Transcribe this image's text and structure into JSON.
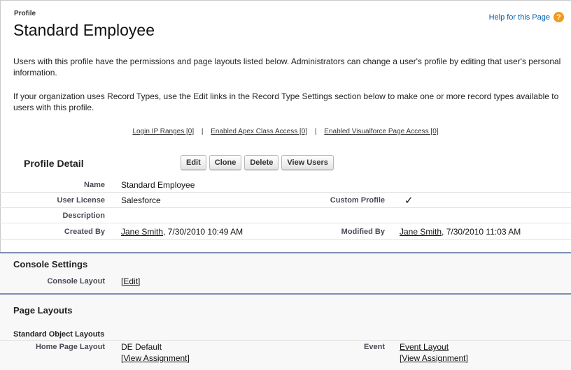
{
  "header": {
    "breadcrumb": "Profile",
    "title": "Standard Employee",
    "help_link": "Help for this Page",
    "help_icon": "question-icon"
  },
  "intro": {
    "paragraph1": "Users with this profile have the permissions and page layouts listed below. Administrators can change a user's profile by editing that user's personal information.",
    "paragraph2": "If your organization uses Record Types, use the Edit links in the Record Type Settings section below to make one or more record types available to users with this profile."
  },
  "quick_links": [
    "Login IP Ranges [0]",
    "Enabled Apex Class Access [0]",
    "Enabled Visualforce Page Access [0]"
  ],
  "quick_link_separator": "|",
  "profile_detail": {
    "heading": "Profile Detail",
    "buttons": [
      "Edit",
      "Clone",
      "Delete",
      "View Users"
    ],
    "name_label": "Name",
    "name_value": "Standard Employee",
    "user_license_label": "User License",
    "user_license_value": "Salesforce",
    "custom_profile_label": "Custom Profile",
    "custom_profile_checked": "✓",
    "description_label": "Description",
    "created_by_label": "Created By",
    "created_by_user": "Jane Smith",
    "created_by_date": ", 7/30/2010 10:49 AM",
    "modified_by_label": "Modified By",
    "modified_by_user": "Jane Smith",
    "modified_by_date": ", 7/30/2010 11:03 AM"
  },
  "console_settings": {
    "heading": "Console Settings",
    "console_layout_label": "Console Layout",
    "edit_link": "Edit",
    "bracket_open": "[",
    "bracket_close": "]"
  },
  "page_layouts": {
    "heading": "Page Layouts",
    "subheading": "Standard Object Layouts",
    "home_label": "Home Page Layout",
    "home_value": "DE Default",
    "home_view_assignment": "View Assignment",
    "event_label": "Event",
    "event_value": "Event Layout",
    "event_view_assignment": "View Assignment"
  },
  "colors": {
    "link_blue": "#015ba7",
    "help_orange": "#f09a1e",
    "section_rule": "#7c8fb0"
  }
}
